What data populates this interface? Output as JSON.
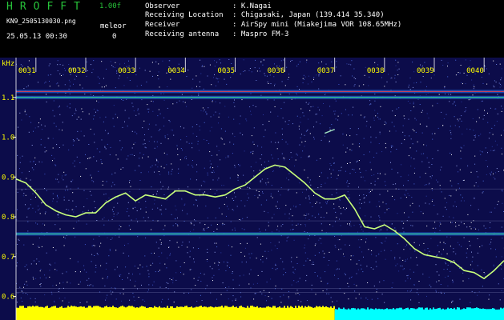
{
  "header": {
    "app_title": "HROFFT",
    "version": "1.00f",
    "filename": "KN9_2505130030.png",
    "unit": "meleor",
    "datetime": "25.05.13 00:30",
    "count": "0",
    "info": [
      {
        "label": "Observer",
        "value": ": K.Nagai"
      },
      {
        "label": "Receiving Location",
        "value": ": Chigasaki, Japan (139.414 35.340)"
      },
      {
        "label": "Receiver",
        "value": ": AirSpy mini (Miakejima VOR 108.65MHz)"
      },
      {
        "label": "Receiving antenna",
        "value": ": Maspro FM-3"
      }
    ]
  },
  "colors": {
    "background": "#0c0c4a",
    "trace": "#c8ff7a",
    "axis_text": "#ffff00",
    "band_high": "#ff4040",
    "band_low": "#40ff80",
    "bottom_left": "#ffff00",
    "bottom_right": "#00ffff"
  },
  "chart_data": {
    "type": "heatmap",
    "xlabel": "",
    "ylabel": "kHz",
    "x_ticks": [
      "0031",
      "0032",
      "0033",
      "0034",
      "0035",
      "0036",
      "0037",
      "0038",
      "0039",
      "0040"
    ],
    "y_ticks": [
      1.1,
      1.0,
      0.9,
      0.8,
      0.7,
      0.6
    ],
    "ylim": [
      0.585,
      1.18
    ],
    "xlim": [
      30.6,
      40.4
    ],
    "horizontal_bands_khz": [
      1.115,
      1.1,
      0.757
    ],
    "signal_trace": {
      "x": [
        30.6,
        30.8,
        31.0,
        31.2,
        31.4,
        31.6,
        31.8,
        32.0,
        32.2,
        32.4,
        32.6,
        32.8,
        33.0,
        33.2,
        33.4,
        33.6,
        33.8,
        34.0,
        34.2,
        34.4,
        34.6,
        34.8,
        35.0,
        35.2,
        35.4,
        35.6,
        35.8,
        36.0,
        36.2,
        36.4,
        36.6,
        36.8,
        37.0,
        37.2,
        37.4,
        37.6,
        37.8,
        38.0,
        38.2,
        38.4,
        38.6,
        38.8,
        39.0,
        39.2,
        39.4,
        39.6,
        39.8,
        40.0,
        40.2,
        40.4
      ],
      "y": [
        0.895,
        0.885,
        0.86,
        0.83,
        0.815,
        0.805,
        0.8,
        0.81,
        0.81,
        0.835,
        0.85,
        0.86,
        0.84,
        0.855,
        0.85,
        0.845,
        0.865,
        0.865,
        0.855,
        0.855,
        0.85,
        0.855,
        0.87,
        0.88,
        0.9,
        0.92,
        0.93,
        0.925,
        0.905,
        0.885,
        0.86,
        0.845,
        0.845,
        0.855,
        0.82,
        0.775,
        0.77,
        0.78,
        0.765,
        0.745,
        0.72,
        0.705,
        0.7,
        0.695,
        0.685,
        0.665,
        0.66,
        0.645,
        0.665,
        0.69
      ]
    },
    "meteor_streak": {
      "x": [
        36.8,
        37.0
      ],
      "y": [
        1.01,
        1.02
      ]
    },
    "bottom_strip": {
      "yellow_until": "0037",
      "cyan_from": "0037"
    }
  }
}
